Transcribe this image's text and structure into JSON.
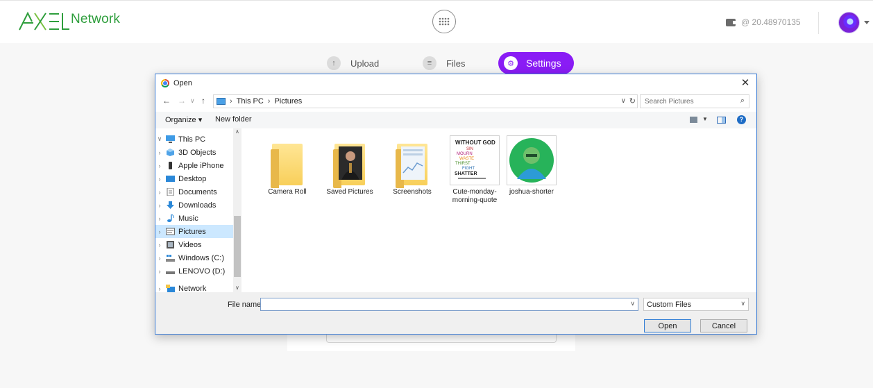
{
  "app": {
    "logo_text": "Network",
    "wallet_balance": "@ 20.48970135",
    "tabs": [
      {
        "label": "Upload"
      },
      {
        "label": "Files"
      },
      {
        "label": "Settings",
        "active": true
      }
    ],
    "accent_color": "#8a1cf5",
    "brand_color": "#2e9e3c"
  },
  "dialog": {
    "title": "Open",
    "close_glyph": "✕",
    "address": {
      "crumbs": [
        "This PC",
        "Pictures"
      ],
      "search_placeholder": "Search Pictures"
    },
    "commands": {
      "organize": "Organize ▾",
      "new_folder": "New folder",
      "help": "?"
    },
    "nav": [
      {
        "label": "This PC",
        "icon": "monitor-icon",
        "expanded": true
      },
      {
        "label": "3D Objects",
        "icon": "cube-icon"
      },
      {
        "label": "Apple iPhone",
        "icon": "phone-icon"
      },
      {
        "label": "Desktop",
        "icon": "desktop-icon"
      },
      {
        "label": "Documents",
        "icon": "document-icon"
      },
      {
        "label": "Downloads",
        "icon": "download-icon"
      },
      {
        "label": "Music",
        "icon": "music-icon"
      },
      {
        "label": "Pictures",
        "icon": "picture-icon",
        "selected": true
      },
      {
        "label": "Videos",
        "icon": "video-icon"
      },
      {
        "label": "Windows (C:)",
        "icon": "drive-icon"
      },
      {
        "label": "LENOVO (D:)",
        "icon": "drive-icon"
      },
      {
        "label": "Network",
        "icon": "network-icon"
      }
    ],
    "items": [
      {
        "label": "Camera Roll",
        "type": "folder"
      },
      {
        "label": "Saved Pictures",
        "type": "folder"
      },
      {
        "label": "Screenshots",
        "type": "folder"
      },
      {
        "label": "Cute-monday-morning-quote",
        "type": "image"
      },
      {
        "label": "joshua-shorter",
        "type": "image"
      }
    ],
    "quote_words": [
      "WITHOUT GOD",
      "SIN",
      "MOURN",
      "WASTE",
      "THIRST",
      "FIGHT",
      "SHATTER"
    ],
    "footer": {
      "file_name_label": "File name:",
      "file_name_value": "",
      "filter_value": "Custom Files",
      "open_label": "Open",
      "cancel_label": "Cancel"
    }
  }
}
